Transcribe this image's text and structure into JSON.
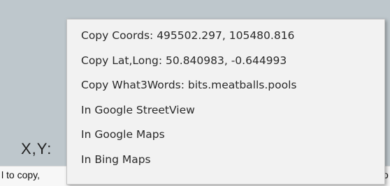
{
  "background": {
    "xy_label": "X,Y:",
    "hint_left": "l to copy,",
    "hint_right": "o"
  },
  "context_menu": {
    "items": [
      "Copy Coords: 495502.297, 105480.816",
      "Copy Lat,Long: 50.840983, -0.644993",
      "Copy What3Words: bits.meatballs.pools",
      "In Google StreetView",
      "In Google Maps",
      "In Bing Maps"
    ]
  },
  "colors": {
    "map_background": "#bec7cc",
    "menu_background": "#f2f2f2",
    "menu_text": "#2a2a2a"
  }
}
